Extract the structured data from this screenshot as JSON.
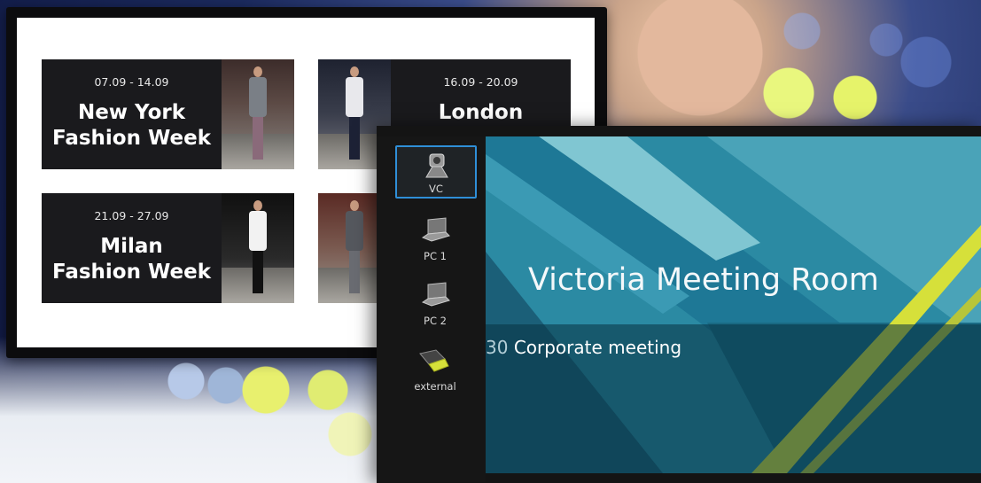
{
  "fashion_screen": {
    "events": [
      {
        "date": "07.09 - 14.09",
        "title": "New York\nFashion Week"
      },
      {
        "date": "16.09 - 20.09",
        "title": "London"
      },
      {
        "date": "21.09 - 27.09",
        "title": "Milan\nFashion Week"
      },
      {
        "date": "",
        "title": ""
      }
    ]
  },
  "meeting_room": {
    "sources": [
      {
        "label": "VC",
        "icon": "video-conference-icon",
        "active": true
      },
      {
        "label": "PC 1",
        "icon": "laptop-icon",
        "active": false
      },
      {
        "label": "PC 2",
        "icon": "laptop-icon",
        "active": false
      },
      {
        "label": "external",
        "icon": "hdmi-connector-icon",
        "active": false
      }
    ],
    "room_name": "Victoria Meeting Room",
    "meeting_time": "30",
    "meeting_name": "Corporate meeting",
    "colors": {
      "accent": "#2f8fd8",
      "background": "#2f8fa8",
      "highlight": "#d6e03a"
    }
  }
}
